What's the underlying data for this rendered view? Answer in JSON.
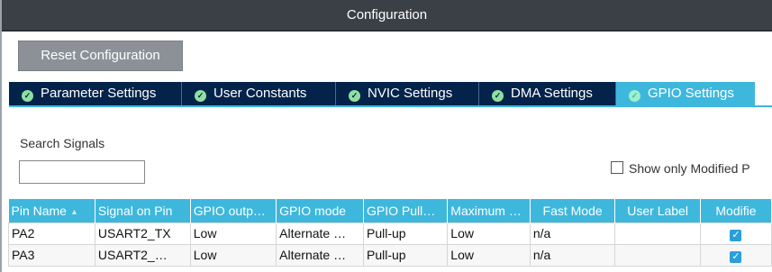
{
  "window": {
    "title": "Configuration"
  },
  "toolbar": {
    "reset_label": "Reset Configuration"
  },
  "tabs": [
    {
      "label": "Parameter Settings",
      "active": false
    },
    {
      "label": "User Constants",
      "active": false
    },
    {
      "label": "NVIC Settings",
      "active": false
    },
    {
      "label": "DMA Settings",
      "active": false
    },
    {
      "label": "GPIO Settings",
      "active": true
    }
  ],
  "search": {
    "label": "Search Signals",
    "value": "",
    "placeholder": ""
  },
  "filter": {
    "show_modified_label": "Show only Modified P",
    "checked": false
  },
  "table": {
    "headers": [
      "Pin Name",
      "Signal on Pin",
      "GPIO outp…",
      "GPIO mode",
      "GPIO Pull…",
      "Maximum …",
      "Fast Mode",
      "User Label",
      "Modifie"
    ],
    "rows": [
      [
        "PA2",
        "USART2_TX",
        "Low",
        "Alternate …",
        "Pull-up",
        "Low",
        "n/a",
        "",
        true
      ],
      [
        "PA3",
        "USART2_…",
        "Low",
        "Alternate …",
        "Pull-up",
        "Low",
        "n/a",
        "",
        true
      ]
    ]
  },
  "colors": {
    "titlebar": "#3b4046",
    "tab_inactive": "#03234b",
    "tab_active": "#3eb7dd",
    "header": "#3eb7dd",
    "checkbox": "#2b9fd8"
  }
}
